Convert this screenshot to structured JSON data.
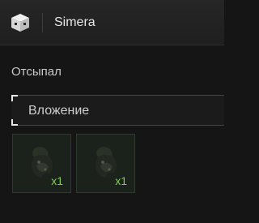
{
  "header": {
    "title": "Simera",
    "logo_icon": "cube-icon"
  },
  "section": {
    "label": "Отсыпал"
  },
  "attachment": {
    "label": "Вложение"
  },
  "items": [
    {
      "icon": "seed-icon",
      "quantity": "x1"
    },
    {
      "icon": "seed-icon",
      "quantity": "x1"
    }
  ],
  "colors": {
    "background": "#151515",
    "header": "#262626",
    "quantity": "#7fd14d",
    "text": "#e7e7e7"
  }
}
